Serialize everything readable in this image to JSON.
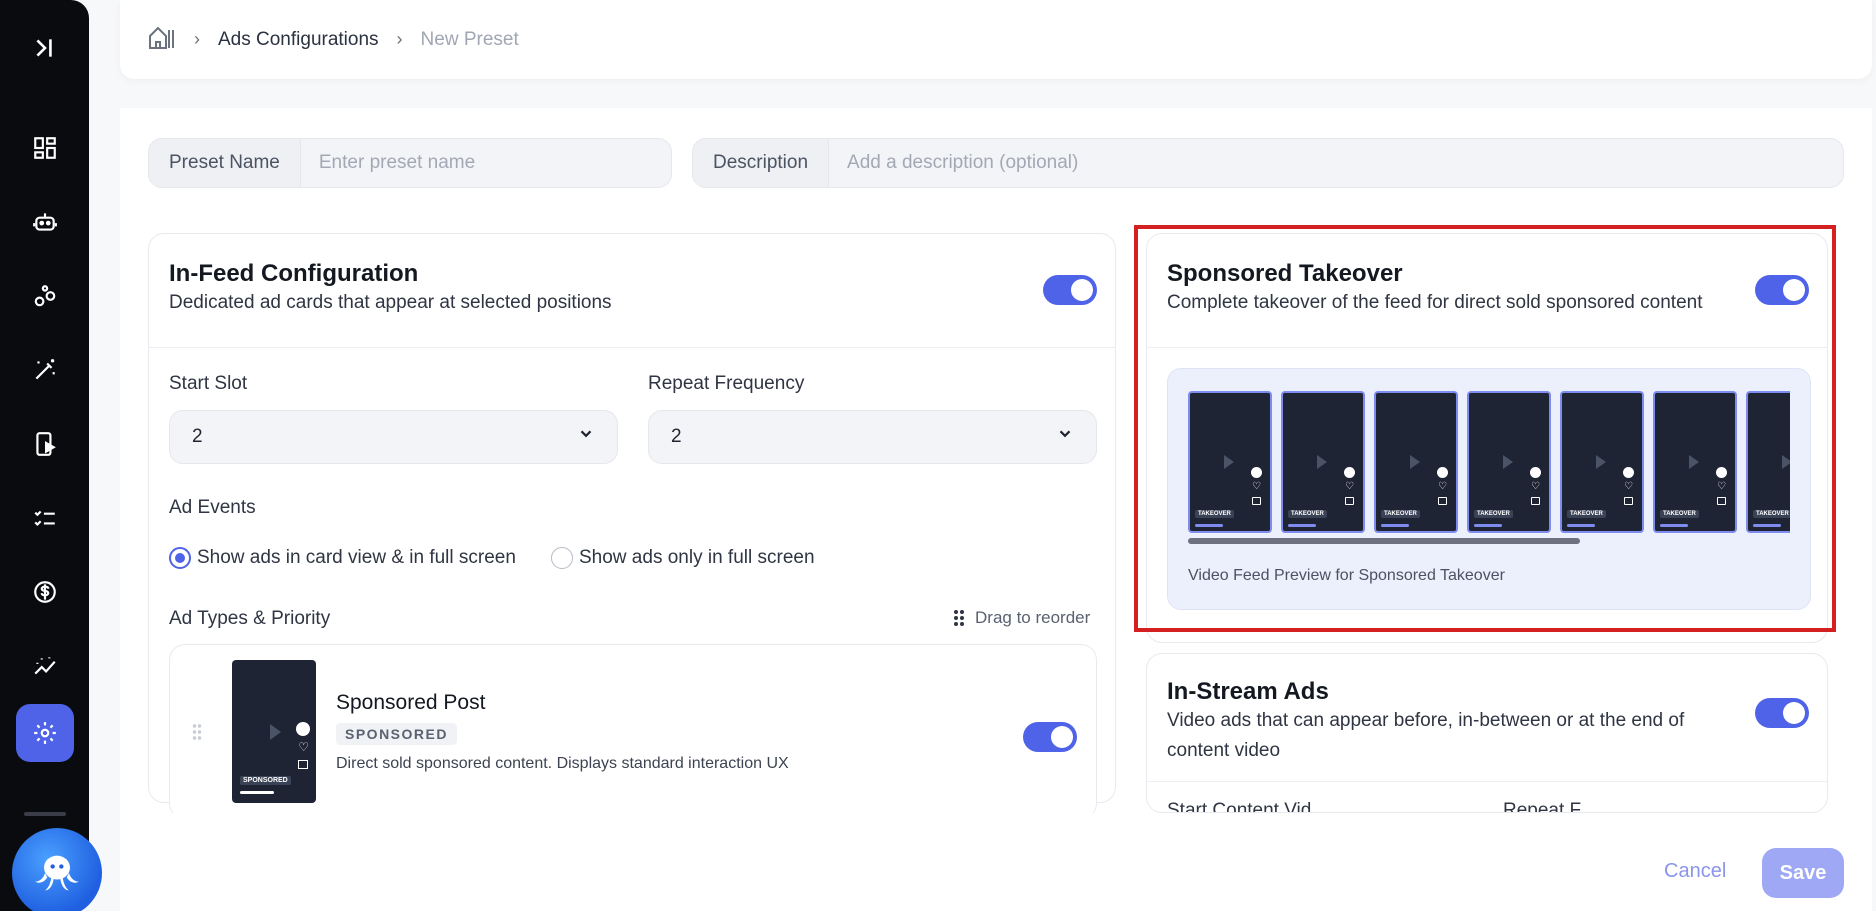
{
  "breadcrumb": {
    "items": [
      "Ads Configurations",
      "New Preset"
    ]
  },
  "form": {
    "preset_name_label": "Preset Name",
    "preset_name_placeholder": "Enter preset name",
    "description_label": "Description",
    "description_placeholder": "Add a description (optional)"
  },
  "in_feed": {
    "title": "In-Feed Configuration",
    "subtitle": "Dedicated ad cards that appear at selected positions",
    "enabled": true,
    "start_slot_label": "Start Slot",
    "start_slot_value": "2",
    "repeat_label": "Repeat Frequency",
    "repeat_value": "2",
    "ad_events_label": "Ad Events",
    "ad_events_options": [
      "Show ads in card view & in full screen",
      "Show ads only in full screen"
    ],
    "ad_events_selected": 0,
    "ad_types_label": "Ad Types & Priority",
    "drag_hint": "Drag to reorder",
    "ad_types": [
      {
        "title": "Sponsored Post",
        "badge": "SPONSORED",
        "description": "Direct sold sponsored content. Displays standard interaction UX",
        "thumb_tag": "SPONSORED",
        "enabled": true
      }
    ]
  },
  "takeover": {
    "title": "Sponsored Takeover",
    "subtitle": "Complete takeover of the feed for direct sold sponsored content",
    "enabled": true,
    "preview_caption": "Video Feed Preview for Sponsored Takeover",
    "preview_tag": "TAKEOVER",
    "preview_count": 7
  },
  "in_stream": {
    "title": "In-Stream Ads",
    "subtitle_line1": "Video ads that can appear before, in-between or at the end of",
    "subtitle_line2": "content video",
    "enabled": true,
    "cut_label_1": "Start Content Vid",
    "cut_label_2": "Repeat F"
  },
  "actions": {
    "cancel": "Cancel",
    "save": "Save"
  },
  "colors": {
    "accent": "#4f63e8",
    "highlight": "#d42020"
  }
}
